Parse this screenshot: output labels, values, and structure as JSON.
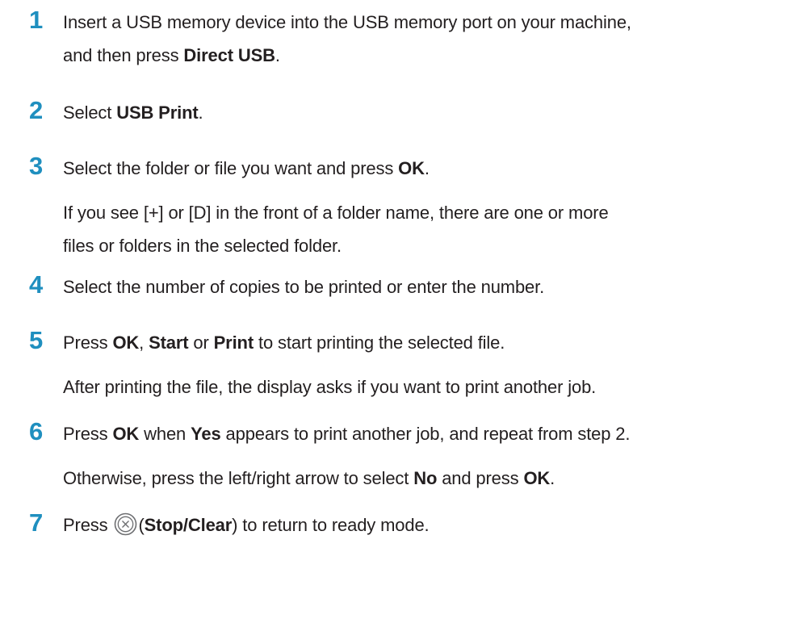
{
  "steps": [
    {
      "number": "1",
      "lines": [
        [
          {
            "t": "Insert a USB memory device into the USB memory port on your machine,"
          }
        ],
        [
          {
            "t": "and then press "
          },
          {
            "t": "Direct USB",
            "b": true
          },
          {
            "t": "."
          }
        ]
      ]
    },
    {
      "number": "2",
      "lines": [
        [
          {
            "t": "Select "
          },
          {
            "t": "USB Print",
            "b": true
          },
          {
            "t": "."
          }
        ]
      ]
    },
    {
      "number": "3",
      "lines": [
        [
          {
            "t": "Select the folder or file you want and press "
          },
          {
            "t": "OK",
            "b": true
          },
          {
            "t": "."
          }
        ],
        [
          {
            "t": "If you see [+] or [D] in the front of a folder name, there are one or more"
          }
        ],
        [
          {
            "t": "files or folders in the selected folder."
          }
        ]
      ]
    },
    {
      "number": "4",
      "lines": [
        [
          {
            "t": "Select the number of copies to be printed or enter the number."
          }
        ]
      ]
    },
    {
      "number": "5",
      "lines": [
        [
          {
            "t": "Press "
          },
          {
            "t": "OK",
            "b": true
          },
          {
            "t": ", "
          },
          {
            "t": "Start",
            "b": true
          },
          {
            "t": " or "
          },
          {
            "t": "Print",
            "b": true
          },
          {
            "t": " to start printing the selected file."
          }
        ],
        [
          {
            "t": "After printing the file, the display asks if you want to print another job."
          }
        ]
      ]
    },
    {
      "number": "6",
      "lines": [
        [
          {
            "t": "Press "
          },
          {
            "t": "OK",
            "b": true
          },
          {
            "t": " when "
          },
          {
            "t": "Yes",
            "b": true
          },
          {
            "t": " appears to print another job, and repeat from step 2."
          }
        ],
        [
          {
            "t": "Otherwise, press the left/right arrow to select "
          },
          {
            "t": "No",
            "b": true
          },
          {
            "t": " and press "
          },
          {
            "t": "OK",
            "b": true
          },
          {
            "t": "."
          }
        ]
      ]
    },
    {
      "number": "7",
      "lines": [
        [
          {
            "t": "Press "
          },
          {
            "icon": "stop-clear-icon"
          },
          {
            "t": "("
          },
          {
            "t": "Stop/Clear",
            "b": true
          },
          {
            "t": ") to return to ready mode."
          }
        ]
      ]
    }
  ],
  "colors": {
    "step_number": "#1f8fbf",
    "text": "#231f20"
  }
}
